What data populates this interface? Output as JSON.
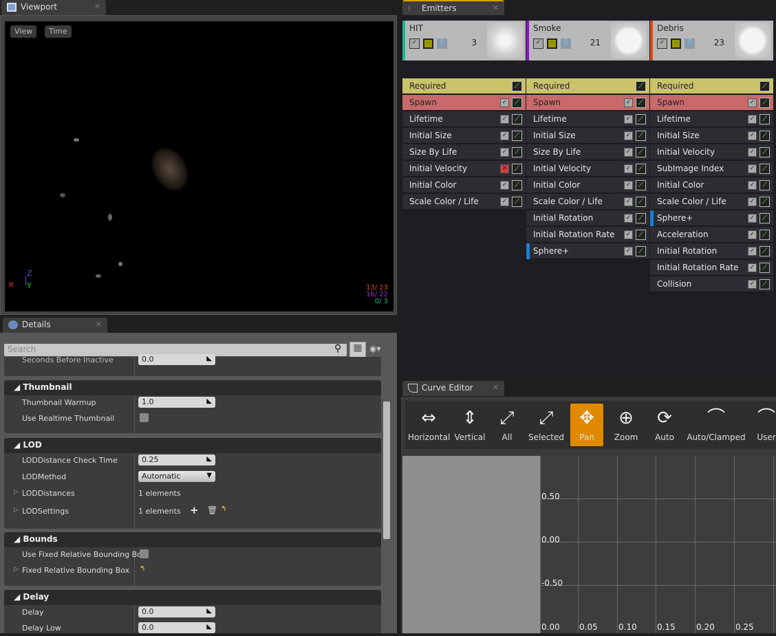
{
  "viewport": {
    "tab": "Viewport",
    "view_btn": "View",
    "time_btn": "Time",
    "axis_z": "Z",
    "axis_y": "Y",
    "stats": [
      {
        "text": "13/  23",
        "color": "#e0501e"
      },
      {
        "text": "16/  22",
        "color": "#9a2fd0"
      },
      {
        "text": "0/   3",
        "color": "#20b890"
      }
    ]
  },
  "details": {
    "tab": "Details",
    "search_placeholder": "Search",
    "partial_row": {
      "label": "Seconds Before Inactive",
      "value": "0.0"
    },
    "thumbnail": {
      "title": "Thumbnail",
      "warmup_label": "Thumbnail Warmup",
      "warmup_value": "1.0",
      "realtime_label": "Use Realtime Thumbnail"
    },
    "lod": {
      "title": "LOD",
      "check_label": "LODDistance Check Time",
      "check_value": "0.25",
      "method_label": "LODMethod",
      "method_value": "Automatic",
      "distances_label": "LODDistances",
      "distances_value": "1 elements",
      "settings_label": "LODSettings",
      "settings_value": "1 elements"
    },
    "bounds": {
      "title": "Bounds",
      "use_fixed_label": "Use Fixed Relative Bounding Box",
      "fixed_label": "Fixed Relative Bounding Box"
    },
    "delay": {
      "title": "Delay",
      "delay_label": "Delay",
      "delay_value": "0.0",
      "delay_low_label": "Delay Low",
      "delay_low_value": "0.0"
    }
  },
  "emitters": {
    "tab": "Emitters",
    "columns": [
      {
        "name": "HIT",
        "count": "3",
        "color": "#1ab890",
        "modules": [
          {
            "label": "Required",
            "type": "required"
          },
          {
            "label": "Spawn",
            "type": "spawn"
          },
          {
            "label": "Lifetime"
          },
          {
            "label": "Initial Size"
          },
          {
            "label": "Size By Life"
          },
          {
            "label": "Initial Velocity",
            "disabled": true
          },
          {
            "label": "Initial Color"
          },
          {
            "label": "Scale Color / Life"
          }
        ]
      },
      {
        "name": "Smoke",
        "count": "21",
        "color": "#8a12c8",
        "modules": [
          {
            "label": "Required",
            "type": "required"
          },
          {
            "label": "Spawn",
            "type": "spawn"
          },
          {
            "label": "Lifetime"
          },
          {
            "label": "Initial Size"
          },
          {
            "label": "Size By Life"
          },
          {
            "label": "Initial Velocity"
          },
          {
            "label": "Initial Color"
          },
          {
            "label": "Scale Color / Life"
          },
          {
            "label": "Initial Rotation"
          },
          {
            "label": "Initial Rotation Rate"
          },
          {
            "label": "Sphere+",
            "marked": true
          }
        ]
      },
      {
        "name": "Debris",
        "count": "23",
        "color": "#e04810",
        "modules": [
          {
            "label": "Required",
            "type": "required"
          },
          {
            "label": "Spawn",
            "type": "spawn"
          },
          {
            "label": "Lifetime"
          },
          {
            "label": "Initial Size"
          },
          {
            "label": "Initial Velocity"
          },
          {
            "label": "SubImage Index"
          },
          {
            "label": "Initial Color"
          },
          {
            "label": "Scale Color / Life"
          },
          {
            "label": "Sphere+",
            "marked": true
          },
          {
            "label": "Acceleration"
          },
          {
            "label": "Initial Rotation"
          },
          {
            "label": "Initial Rotation Rate"
          },
          {
            "label": "Collision"
          }
        ]
      }
    ]
  },
  "curve_editor": {
    "tab": "Curve Editor",
    "tools": [
      {
        "label": "Horizontal",
        "icon": "fit-horizontal-icon",
        "glyph": "⇔"
      },
      {
        "label": "Vertical",
        "icon": "fit-vertical-icon",
        "glyph": "⇕"
      },
      {
        "label": "All",
        "icon": "fit-all-icon",
        "glyph": "⤢"
      },
      {
        "label": "Selected",
        "icon": "fit-selected-icon",
        "glyph": "⤢"
      },
      {
        "label": "Pan",
        "icon": "pan-icon",
        "glyph": "✥",
        "active": true
      },
      {
        "label": "Zoom",
        "icon": "zoom-icon",
        "glyph": "⊕"
      },
      {
        "label": "Auto",
        "icon": "tangent-auto-icon",
        "glyph": "⟳"
      },
      {
        "label": "Auto/Clamped",
        "icon": "tangent-auto-clamped-icon",
        "glyph": "⌒"
      },
      {
        "label": "User",
        "icon": "tangent-user-icon",
        "glyph": "⌒"
      }
    ],
    "active_color": "#e08a00",
    "y_labels": [
      "0.50",
      "0.00",
      "-0.50"
    ],
    "x_labels": [
      "0.00",
      "0.05",
      "0.10",
      "0.15",
      "0.20",
      "0.25"
    ]
  }
}
